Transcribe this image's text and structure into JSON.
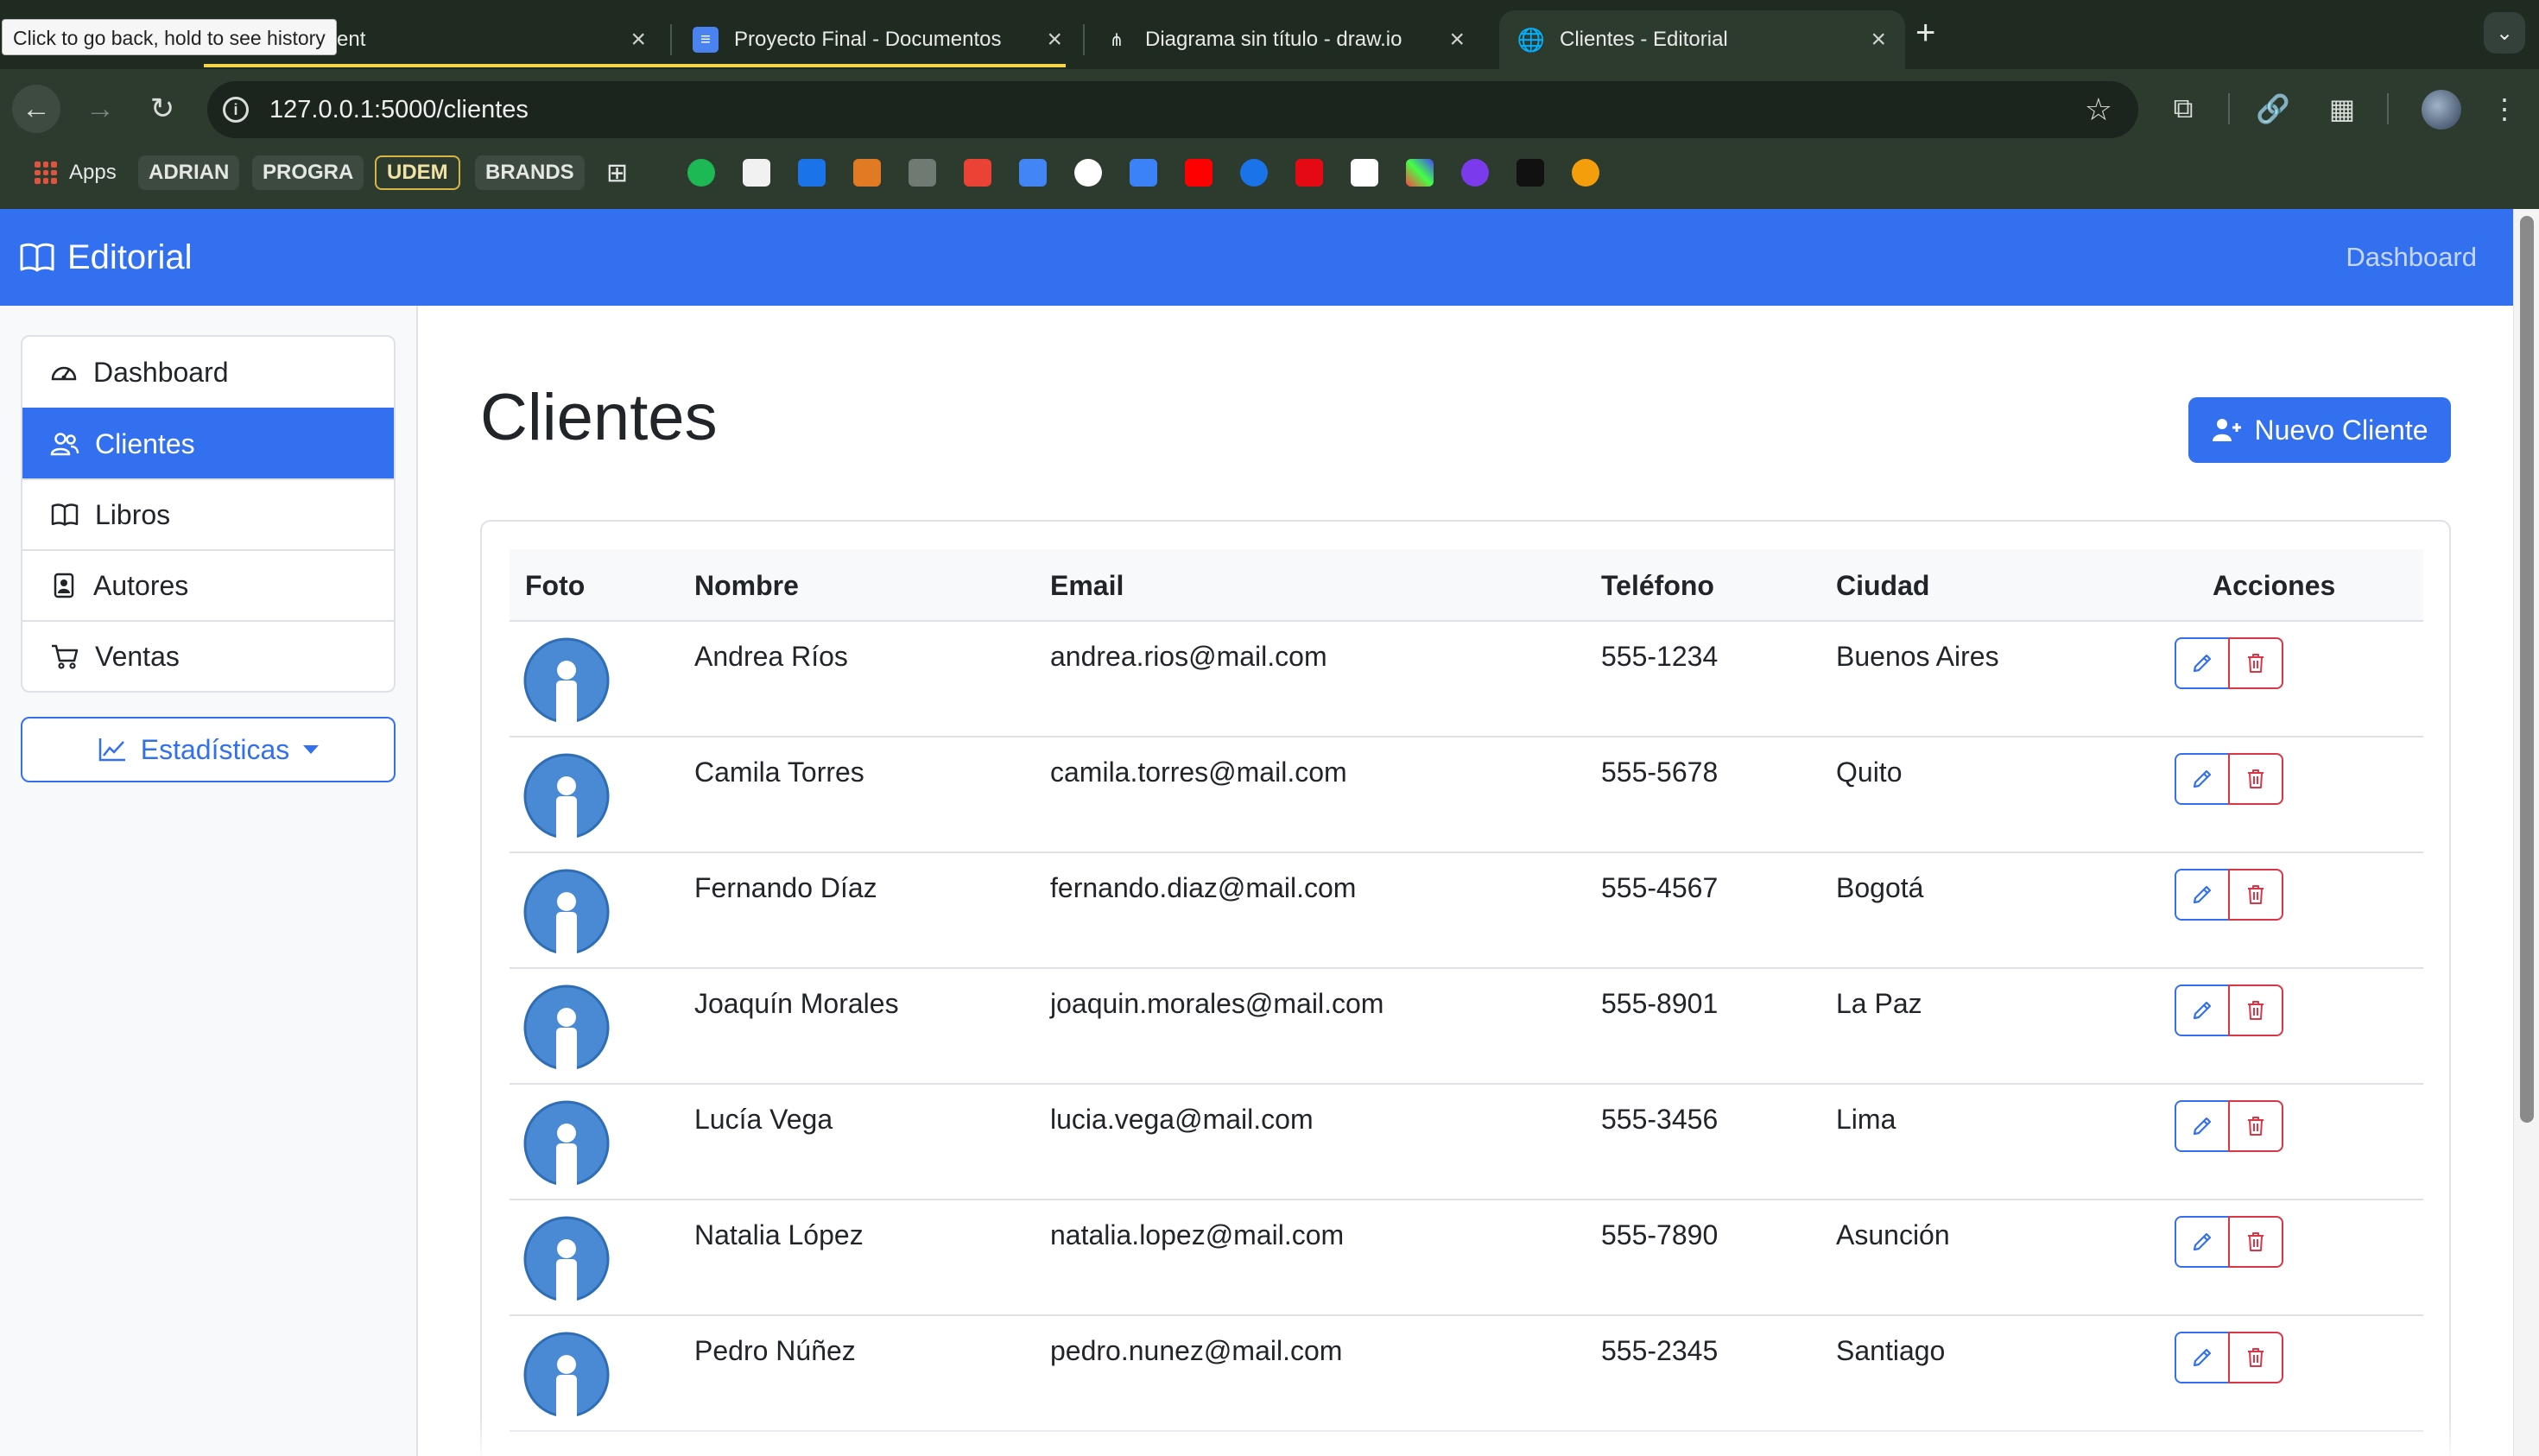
{
  "browser": {
    "tooltip": "Click to go back, hold to see history",
    "tabs": [
      {
        "title": "ntent"
      },
      {
        "title": "Proyecto Final - Documentos"
      },
      {
        "title": "Diagrama sin título - draw.io"
      },
      {
        "title": "Clientes - Editorial"
      }
    ],
    "url": "127.0.0.1:5000/clientes",
    "bookmarks": {
      "apps": "Apps",
      "folders": [
        "ADRIAN",
        "PROGRA",
        "UDEM",
        "BRANDS"
      ]
    }
  },
  "app": {
    "brand": "Editorial",
    "nav_dashboard": "Dashboard",
    "sidebar": {
      "items": [
        {
          "label": "Dashboard"
        },
        {
          "label": "Clientes"
        },
        {
          "label": "Libros"
        },
        {
          "label": "Autores"
        },
        {
          "label": "Ventas"
        }
      ],
      "stats_label": "Estadísticas"
    },
    "page_title": "Clientes",
    "new_button": "Nuevo Cliente",
    "table": {
      "headers": {
        "foto": "Foto",
        "nombre": "Nombre",
        "email": "Email",
        "telefono": "Teléfono",
        "ciudad": "Ciudad",
        "acciones": "Acciones"
      },
      "rows": [
        {
          "nombre": "Andrea Ríos",
          "email": "andrea.rios@mail.com",
          "telefono": "555-1234",
          "ciudad": "Buenos Aires"
        },
        {
          "nombre": "Camila Torres",
          "email": "camila.torres@mail.com",
          "telefono": "555-5678",
          "ciudad": "Quito"
        },
        {
          "nombre": "Fernando Díaz",
          "email": "fernando.diaz@mail.com",
          "telefono": "555-4567",
          "ciudad": "Bogotá"
        },
        {
          "nombre": "Joaquín Morales",
          "email": "joaquin.morales@mail.com",
          "telefono": "555-8901",
          "ciudad": "La Paz"
        },
        {
          "nombre": "Lucía Vega",
          "email": "lucia.vega@mail.com",
          "telefono": "555-3456",
          "ciudad": "Lima"
        },
        {
          "nombre": "Natalia López",
          "email": "natalia.lopez@mail.com",
          "telefono": "555-7890",
          "ciudad": "Asunción"
        },
        {
          "nombre": "Pedro Núñez",
          "email": "pedro.nunez@mail.com",
          "telefono": "555-2345",
          "ciudad": "Santiago"
        }
      ]
    }
  },
  "colors": {
    "primary": "#3370f0",
    "danger": "#dc3545",
    "avatar": "#4a8ad4"
  }
}
